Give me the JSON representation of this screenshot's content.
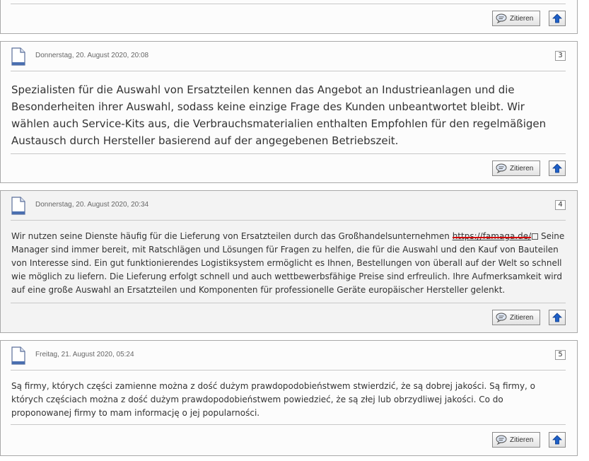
{
  "posts": [
    {
      "date": "",
      "number": "",
      "body": "",
      "quote_label": "Zitieren"
    },
    {
      "date": "Donnerstag, 20. August 2020, 20:08",
      "number": "3",
      "body": "Spezialisten für die Auswahl von Ersatzteilen kennen das Angebot an Industrieanlagen und die Besonderheiten ihrer Auswahl, sodass keine einzige Frage des Kunden unbeantwortet bleibt. Wir wählen auch Service-Kits aus, die Verbrauchsmaterialien enthalten Empfohlen für den regelmäßigen Austausch durch Hersteller basierend auf der angegebenen Betriebszeit.",
      "quote_label": "Zitieren"
    },
    {
      "date": "Donnerstag, 20. August 2020, 20:34",
      "number": "4",
      "body_before": "Wir nutzen seine Dienste häufig für die Lieferung von Ersatzteilen durch das Großhandelsunternehmen ",
      "link_text": "https://famaga.de/",
      "body_after": " Seine Manager sind immer bereit, mit Ratschlägen und Lösungen für Fragen zu helfen, die für die Auswahl und den Kauf von Bauteilen von Interesse sind. Ein gut funktionierendes Logistiksystem ermöglicht es Ihnen, Bestellungen von überall auf der Welt so schnell wie möglich zu liefern. Die Lieferung erfolgt schnell und auch wettbewerbsfähige Preise sind erfreulich. Ihre Aufmerksamkeit wird auf eine große Auswahl an Ersatzteilen und Komponenten für professionelle Geräte europäischer Hersteller gelenkt.",
      "quote_label": "Zitieren"
    },
    {
      "date": "Freitag, 21. August 2020, 05:24",
      "number": "5",
      "body": "Są firmy, których części zamienne można z dość dużym prawdopodobieństwem stwierdzić, że są dobrej jakości. Są firmy, o których częściach można z dość dużym prawdopodobieństwem powiedzieć, że są złej lub obrzydliwej jakości. Co do proponowanej firmy to mam informację o jej popularności.",
      "quote_label": "Zitieren"
    }
  ],
  "icons": {
    "document": "document-icon",
    "quote": "speech-bubble-icon",
    "top": "arrow-up-icon"
  },
  "colors": {
    "border": "#a9a9a9",
    "post_bg": "#fcfcfc",
    "post_alt_bg": "#f3f3f3",
    "top_arrow": "#1d5fc7",
    "redaction": "#d40000"
  }
}
